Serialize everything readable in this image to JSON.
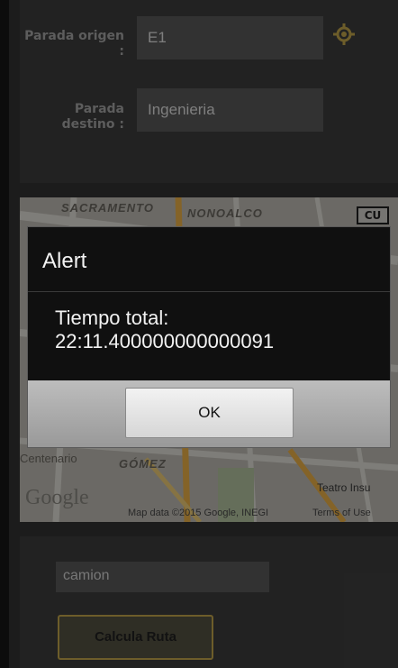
{
  "form": {
    "origin_label": "Parada origen :",
    "origin_value": "E1",
    "destination_label": "Parada destino :",
    "destination_value": "Ingenieria"
  },
  "map": {
    "labels": {
      "sacramento": "SACRAMENTO",
      "nonoalco": "NONOALCO",
      "cu": "CU",
      "centenario": "Centenario",
      "gomez": "GÓMEZ",
      "teatro": "Teatro Insu",
      "google": "Google"
    },
    "attribution": "Map data ©2015 Google, INEGI",
    "terms": "Terms of Use"
  },
  "dialog": {
    "title": "Alert",
    "message": "Tiempo total:\n22:11.400000000000091",
    "ok_label": "OK"
  },
  "bottom": {
    "vehicle_value": "camion",
    "calc_label": "Calcula Ruta"
  },
  "colors": {
    "accent": "#c7a94e",
    "marker": "#1f5f8b"
  }
}
